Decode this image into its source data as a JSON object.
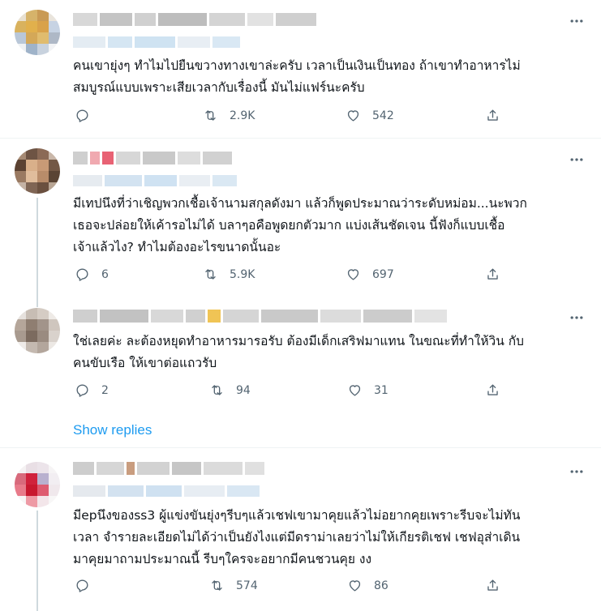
{
  "icons": {
    "more": "more-horizontal-icon",
    "reply": "reply-icon",
    "retweet": "retweet-icon",
    "like": "heart-icon",
    "share": "share-icon"
  },
  "colors": {
    "accent": "#1d9bf0",
    "icon": "#536471",
    "divider": "#eff3f4",
    "thread": "#cfd9de"
  },
  "show_replies_label": "Show replies",
  "tweets": [
    {
      "text": "คนเขายุ่งๆ ทำไมไปยืนขวางทางเขาล่ะครับ เวลาเป็นเงินเป็นทอง ถ้าเขาทำอาหารไม่\nสมบูรณ์แบบเพราะเสียเวลากับเรื่องนี้ มันไม่แฟร์นะครับ",
      "replies": "",
      "retweets": "2.9K",
      "likes": "542"
    },
    {
      "text": "มีเทปนึงที่ว่าเชิญพวกเชื้อเจ้านามสกุลดังมา แล้วก็พูดประมาณว่าระดับหม่อม...นะพวก\nเธอจะปล่อยให้เค้ารอไม่ได้ บลาๆอคือพูดยกตัวมาก แบ่งเส้นชัดเจน นี้ฟังก็แบบเชื้อ\nเจ้าแล้วไง? ทำไมต้องอะไรขนาดนั้นอะ",
      "replies": "6",
      "retweets": "5.9K",
      "likes": "697"
    },
    {
      "text": "ใช่เลยค่ะ ละต้องหยุดทำอาหารมารอรับ ต้องมีเด็กเสริฟมาแทน ในขณะที่ทำให้วิน กับ\nคนขับเรือ ให้เขาต่อแถวรับ",
      "replies": "2",
      "retweets": "94",
      "likes": "31"
    },
    {
      "text": "มีepนึงของss3 ผู้แข่งขันยุ่งๆรีบๆแล้วเชฟเขามาคุยแล้วไม่อยากคุยเพราะรีบจะไม่ทัน\nเวลา จำรายละเอียดไม่ได้ว่าเป็นยังไงแต่มีดราม่าเลยว่าไม่ให้เกียรติเชฟ เชฟอุส่าเดิน\nมาคุยมาถามประมาณนี้ รีบๆใครจะอยากมีคนชวนคุย งง",
      "replies": "",
      "retweets": "574",
      "likes": "86"
    }
  ]
}
